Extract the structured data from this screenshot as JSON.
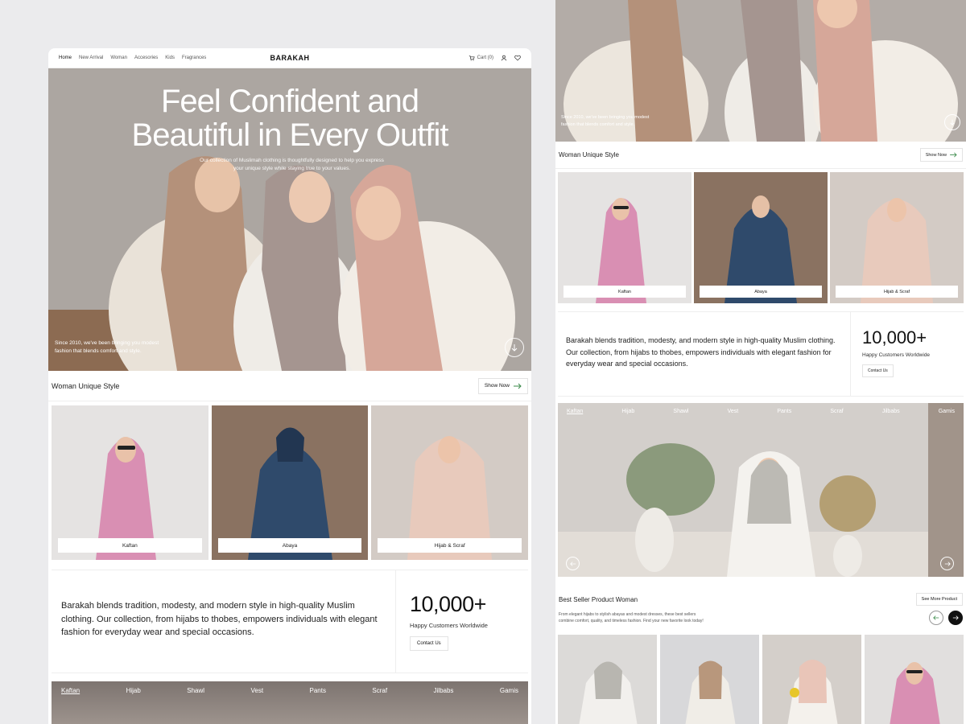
{
  "nav": {
    "links": [
      "Home",
      "New Arrival",
      "Woman",
      "Accesories",
      "Kids",
      "Fragrances"
    ],
    "brand": "BARAKAH",
    "cart_label": "Cart (0)"
  },
  "hero": {
    "title_line1": "Feel Confident and",
    "title_line2": "Beautiful in Every Outfit",
    "subtitle": "Our collection of Muslimah clothing is thoughtfully designed to help you express your unique style while staying true to your values.",
    "note": "Since 2010, we've been bringing you modest fashion that blends comfort and style."
  },
  "collection": {
    "title": "Woman Unique Style",
    "show_label": "Show Now",
    "categories": [
      "Kaftan",
      "Abaya",
      "Hijab & Scraf"
    ]
  },
  "about": {
    "text": "Barakah blends tradition, modesty, and modern style in high-quality Muslim clothing. Our collection, from hijabs to thobes, empowers individuals with elegant fashion for everyday wear and special occasions.",
    "stat_number": "10,000+",
    "stat_caption": "Happy Customers Worldwide",
    "contact_label": "Contact Us"
  },
  "tabs": [
    "Kaftan",
    "Hijab",
    "Shawl",
    "Vest",
    "Pants",
    "Scraf",
    "Jilbabs",
    "Gamis"
  ],
  "best_seller": {
    "title": "Best Seller Product Woman",
    "see_more_label": "See More Product",
    "description": "From elegant hijabs to stylish abayas and modest dresses, these best sellers combine comfort, quality, and timeless fashion. Find your new favorite look today!"
  },
  "colors": {
    "accent_green": "#3a8a4a",
    "text_dark": "#1a1a1a",
    "page_bg": "#ebebed"
  }
}
